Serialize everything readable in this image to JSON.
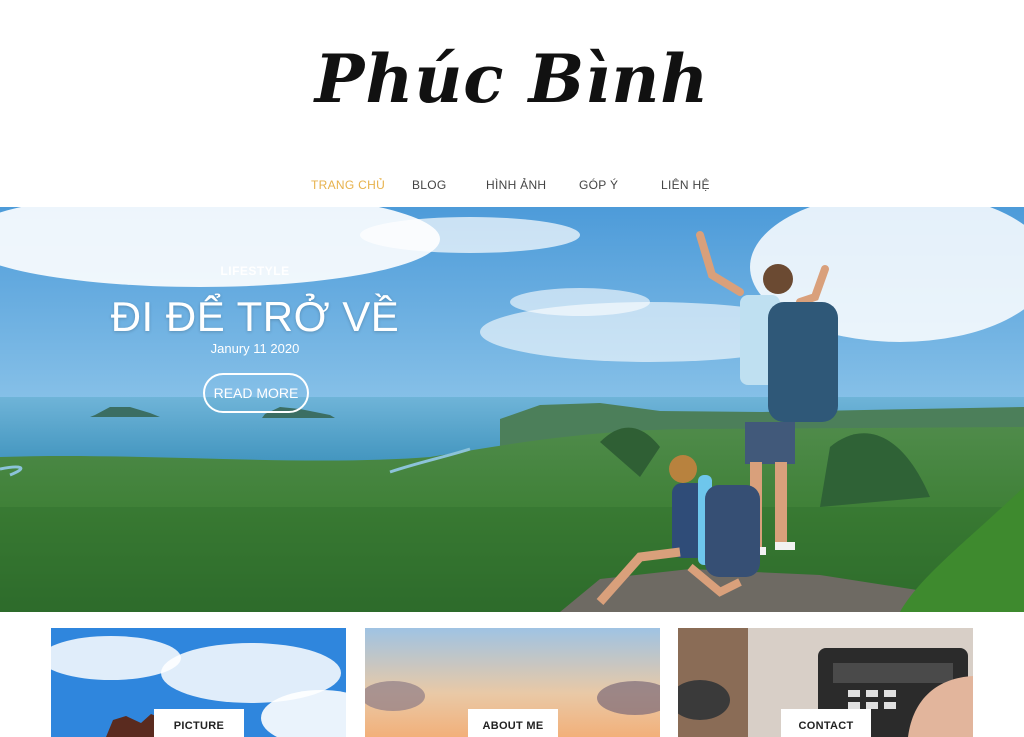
{
  "site": {
    "logo": "Phúc Bình"
  },
  "nav": {
    "items": [
      {
        "label": "TRANG CHỦ",
        "active": true
      },
      {
        "label": "BLOG"
      },
      {
        "label": "HÌNH ẢNH"
      },
      {
        "label": "GÓP Ý"
      },
      {
        "label": "LIÊN HỆ"
      }
    ]
  },
  "hero": {
    "category": "LIFESTYLE",
    "title": "ĐI ĐỂ TRỞ VỀ",
    "date": "Janury 11 2020",
    "button_label": "READ MORE"
  },
  "cards": [
    {
      "label": "PICTURE"
    },
    {
      "label": "ABOUT ME"
    },
    {
      "label": "CONTACT"
    }
  ],
  "colors": {
    "accent": "#e7b24c",
    "text": "#444444"
  }
}
